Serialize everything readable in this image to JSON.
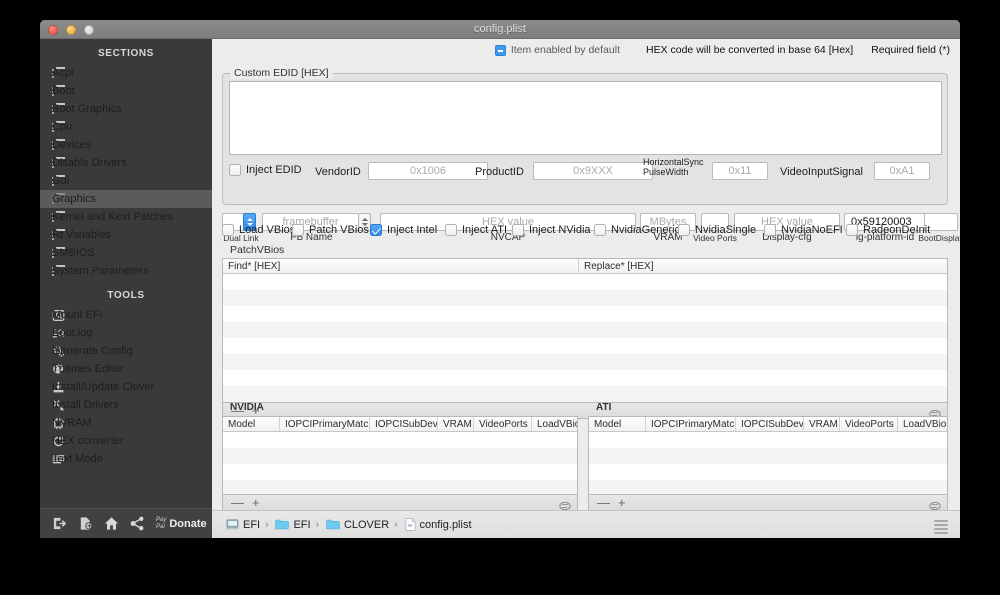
{
  "window": {
    "title": "config.plist",
    "traffic": {
      "close": "close-button",
      "minimize": "minimize-button",
      "maximize": "maximize-button"
    }
  },
  "sidebar": {
    "sections_header": "SECTIONS",
    "tools_header": "TOOLS",
    "sections": [
      {
        "label": "Acpi",
        "selected": false
      },
      {
        "label": "Boot",
        "selected": false
      },
      {
        "label": "Boot Graphics",
        "selected": false
      },
      {
        "label": "Cpu",
        "selected": false
      },
      {
        "label": "Devices",
        "selected": false
      },
      {
        "label": "Disable Drivers",
        "selected": false
      },
      {
        "label": "Gui",
        "selected": false
      },
      {
        "label": "Graphics",
        "selected": true
      },
      {
        "label": "Kernel and Kext Patches",
        "selected": false
      },
      {
        "label": "Rt Variables",
        "selected": false
      },
      {
        "label": "SMBIOS",
        "selected": false
      },
      {
        "label": "System Parameters",
        "selected": false
      }
    ],
    "tools": [
      {
        "label": "Mount EFI",
        "icon": "mount-efi-icon"
      },
      {
        "label": "Boot.log",
        "icon": "boot-log-icon"
      },
      {
        "label": "Generate Config",
        "icon": "gear-icon"
      },
      {
        "label": "Themes Editor",
        "icon": "palette-icon"
      },
      {
        "label": "Install/Update Clover",
        "icon": "download-icon"
      },
      {
        "label": "Install Drivers",
        "icon": "tools-icon"
      },
      {
        "label": "NVRAM",
        "icon": "chip-icon"
      },
      {
        "label": "HEX converter",
        "icon": "refresh-icon"
      },
      {
        "label": "Text Mode",
        "icon": "text-lines-icon"
      }
    ],
    "toolbar": {
      "import_label": "import-icon",
      "export_label": "export-icon",
      "home_label": "home-icon",
      "share_label": "share-icon",
      "paypal_line1": "Pay",
      "paypal_line2": "Pal",
      "donate_label": "Donate"
    }
  },
  "hints": {
    "item_enabled": "Item enabled by default",
    "hex_note": "HEX code will be converted in base 64 [Hex]",
    "required": "Required field (*)"
  },
  "graphics": {
    "edid_group_label": "Custom EDID [HEX]",
    "edid_value": "",
    "row1": {
      "inject_edid": {
        "label": "Inject EDID",
        "checked": false
      },
      "vendor_id": {
        "label": "VendorID",
        "placeholder": "0x1006",
        "value": ""
      },
      "product_id": {
        "label": "ProductID",
        "placeholder": "0x9XXX",
        "value": ""
      },
      "hsync": {
        "label_line1": "HorizontalSync",
        "label_line2": "PulseWidth",
        "placeholder": "0x11",
        "value": ""
      },
      "video_input_signal": {
        "label": "VideoInputSignal",
        "placeholder": "0xA1",
        "value": ""
      }
    },
    "row2": {
      "dual_link": {
        "sublabel": "Dual Link",
        "value": ""
      },
      "fb_name": {
        "sublabel": "FB Name",
        "placeholder": "framebuffer",
        "value": ""
      },
      "nvcap": {
        "sublabel": "NVCAP",
        "placeholder": "HEX value",
        "value": ""
      },
      "vram": {
        "sublabel": "VRAM",
        "placeholder": "MBytes",
        "value": ""
      },
      "video_ports": {
        "sublabel": "Video Ports",
        "placeholder": "",
        "value": ""
      },
      "display_cfg": {
        "sublabel": "Display-cfg",
        "placeholder": "HEX value",
        "value": ""
      },
      "ig_platform_id": {
        "sublabel": "ig-platform-id",
        "value": "0x59120003"
      },
      "boot_display": {
        "sublabel": "BootDisplay",
        "placeholder": "",
        "value": ""
      }
    },
    "checkboxes": [
      {
        "label": "Load VBios",
        "checked": false
      },
      {
        "label": "Patch VBios",
        "checked": false
      },
      {
        "label": "Inject Intel",
        "checked": true
      },
      {
        "label": "Inject ATI",
        "checked": false
      },
      {
        "label": "Inject NVidia",
        "checked": false
      },
      {
        "label": "NvidiaGeneric",
        "checked": false
      },
      {
        "label": "NvidiaSingle",
        "checked": false
      },
      {
        "label": "NvidiaNoEFI",
        "checked": false
      },
      {
        "label": "RadeonDeInit",
        "checked": false
      }
    ],
    "patchvbios": {
      "group_label": "PatchVBios",
      "columns": [
        "Find* [HEX]",
        "Replace* [HEX]"
      ],
      "rows": [],
      "row_count": 8,
      "footer": {
        "remove": "—",
        "add": "+",
        "clear": "clear-icon"
      }
    },
    "nvidia": {
      "group_label": "NVIDIA",
      "columns": [
        "Model",
        "IOPCIPrimaryMatch",
        "IOPCISubDevId",
        "VRAM",
        "VideoPorts",
        "LoadVBios"
      ],
      "rows": [],
      "row_count": 4,
      "footer": {
        "remove": "—",
        "add": "+",
        "clear": "clear-icon"
      }
    },
    "ati": {
      "group_label": "ATI",
      "columns": [
        "Model",
        "IOPCIPrimaryMatch",
        "IOPCISubDevId",
        "VRAM",
        "VideoPorts",
        "LoadVBios"
      ],
      "rows": [],
      "row_count": 4,
      "footer": {
        "remove": "—",
        "add": "+",
        "clear": "clear-icon"
      }
    }
  },
  "breadcrumb": {
    "items": [
      {
        "label": "EFI",
        "icon": "disk-icon"
      },
      {
        "label": "EFI",
        "icon": "folder-icon"
      },
      {
        "label": "CLOVER",
        "icon": "folder-icon"
      },
      {
        "label": "config.plist",
        "icon": "plist-file-icon"
      }
    ],
    "separator": "›",
    "menu": "hamburger-menu-icon"
  },
  "colors": {
    "accent_blue": "#2f8ae8",
    "sidebar_bg": "#3a3a3a",
    "selected_text": "#7f9ecb",
    "content_bg": "#ececec"
  }
}
